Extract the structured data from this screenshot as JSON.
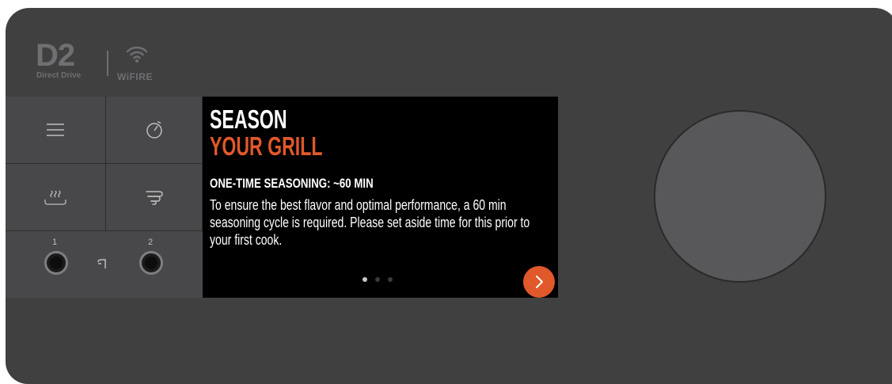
{
  "logo": {
    "brand_mark": "D2",
    "brand_sub": "Direct Drive",
    "wifi_label": "WiFIRE",
    "wifi_icon": "wifi-icon"
  },
  "buttons": {
    "menu_icon": "menu-icon",
    "timer_icon": "timer-icon",
    "keep_warm_icon": "keep-warm-icon",
    "super_smoke_icon": "super-smoke-icon"
  },
  "probes": {
    "probe1_label": "1",
    "probe2_label": "2",
    "probe_icon": "probe-icon"
  },
  "screen": {
    "title_line1": "SEASON",
    "title_line2": "YOUR GRILL",
    "subheading": "ONE-TIME SEASONING: ~60 MIN",
    "body_text": "To ensure the best flavor and optimal performance, a 60 min seasoning cycle is required. Please set aside time for this prior to your first cook.",
    "page_dots": [
      true,
      false,
      false
    ],
    "next_icon": "chevron-right-icon",
    "accent_color": "#e1582a"
  },
  "knob": {
    "name": "control-dial"
  }
}
